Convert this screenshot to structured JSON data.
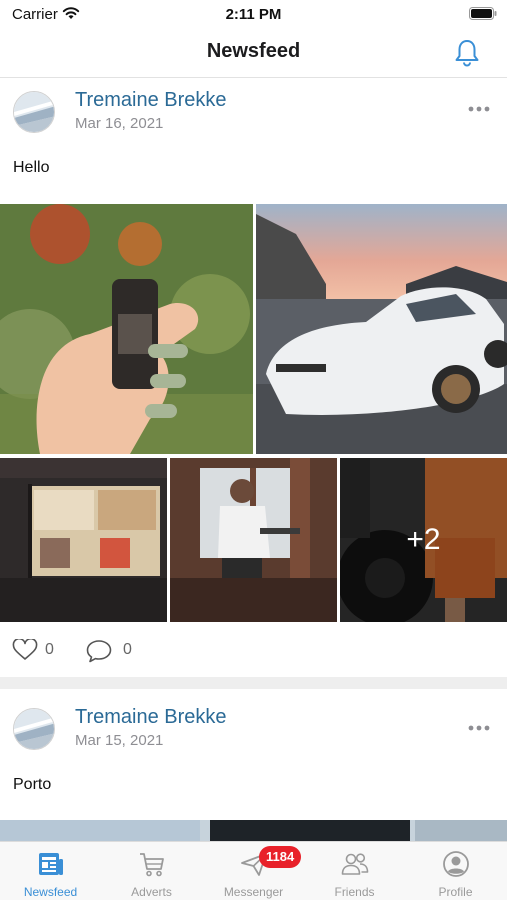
{
  "status_bar": {
    "carrier": "Carrier",
    "time": "2:11 PM"
  },
  "nav": {
    "title": "Newsfeed",
    "bell_icon": "bell-icon"
  },
  "posts": [
    {
      "author": "Tremaine Brekke",
      "date": "Mar 16, 2021",
      "text": "Hello",
      "images": [
        "hand-holding-bottle",
        "white-sports-car",
        "lit-kiosk-window",
        "man-at-cabin-door",
        "gym-barbell"
      ],
      "more_images_label": "+2",
      "likes": "0",
      "comments": "0"
    },
    {
      "author": "Tremaine Brekke",
      "date": "Mar 15, 2021",
      "text": "Porto"
    }
  ],
  "tab_bar": {
    "active": "Newsfeed",
    "tabs": [
      {
        "label": "Newsfeed",
        "icon": "newspaper-icon"
      },
      {
        "label": "Adverts",
        "icon": "cart-icon"
      },
      {
        "label": "Messenger",
        "icon": "paper-plane-icon",
        "badge": "1184"
      },
      {
        "label": "Friends",
        "icon": "people-icon"
      },
      {
        "label": "Profile",
        "icon": "profile-icon"
      }
    ]
  },
  "colors": {
    "accent": "#3a8fd6",
    "author_name": "#2b6a96",
    "badge": "#e8212a"
  }
}
